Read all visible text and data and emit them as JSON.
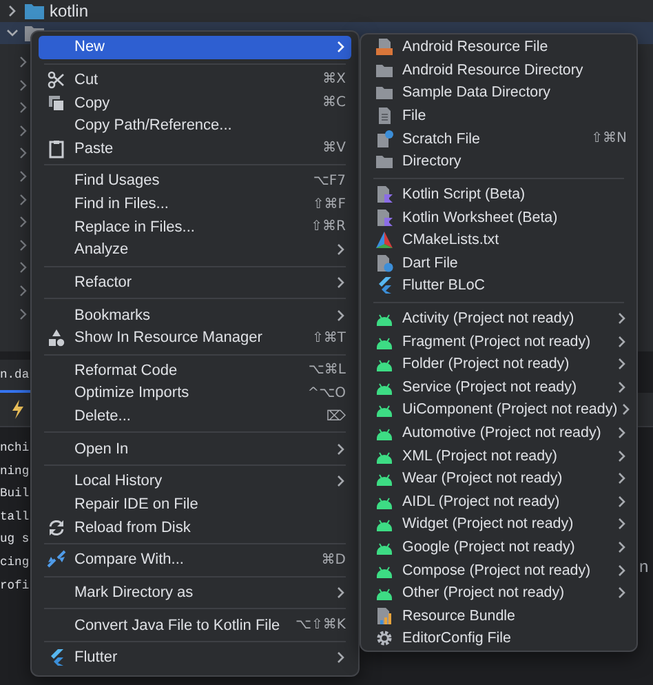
{
  "project_tree": {
    "items": [
      {
        "label": "kotlin",
        "expanded": false,
        "selected": false
      },
      {
        "expanded": true,
        "selected": true
      }
    ]
  },
  "editor_tab": {
    "label": "n.da"
  },
  "terminal": {
    "lines": [
      "nchi",
      "ning",
      "Buil",
      "tall",
      "ug s",
      "cing",
      "rofi"
    ]
  },
  "right_fragment": "n",
  "context_menu": {
    "groups": [
      [
        {
          "label": "New",
          "submenu": true,
          "selected": true
        }
      ],
      [
        {
          "label": "Cut",
          "shortcut": "⌘X",
          "submenu": false,
          "selected": false
        },
        {
          "label": "Copy",
          "shortcut": "⌘C",
          "submenu": false,
          "selected": false
        },
        {
          "label": "Copy Path/Reference...",
          "submenu": false,
          "selected": false
        },
        {
          "label": "Paste",
          "shortcut": "⌘V",
          "submenu": false,
          "selected": false
        }
      ],
      [
        {
          "label": "Find Usages",
          "shortcut": "⌥F7",
          "submenu": false,
          "selected": false
        },
        {
          "label": "Find in Files...",
          "shortcut": "⇧⌘F",
          "submenu": false,
          "selected": false
        },
        {
          "label": "Replace in Files...",
          "shortcut": "⇧⌘R",
          "submenu": false,
          "selected": false
        },
        {
          "label": "Analyze",
          "submenu": true,
          "selected": false
        }
      ],
      [
        {
          "label": "Refactor",
          "submenu": true,
          "selected": false
        }
      ],
      [
        {
          "label": "Bookmarks",
          "submenu": true,
          "selected": false
        },
        {
          "label": "Show In Resource Manager",
          "shortcut": "⇧⌘T",
          "submenu": false,
          "selected": false
        }
      ],
      [
        {
          "label": "Reformat Code",
          "shortcut": "⌥⌘L",
          "submenu": false,
          "selected": false
        },
        {
          "label": "Optimize Imports",
          "shortcut": "^⌥O",
          "submenu": false,
          "selected": false
        },
        {
          "label": "Delete...",
          "shortcut": "⌦",
          "submenu": false,
          "selected": false
        }
      ],
      [
        {
          "label": "Open In",
          "submenu": true,
          "selected": false
        }
      ],
      [
        {
          "label": "Local History",
          "submenu": true,
          "selected": false
        },
        {
          "label": "Repair IDE on File",
          "submenu": false,
          "selected": false
        },
        {
          "label": "Reload from Disk",
          "submenu": false,
          "selected": false
        }
      ],
      [
        {
          "label": "Compare With...",
          "shortcut": "⌘D",
          "submenu": false,
          "selected": false
        }
      ],
      [
        {
          "label": "Mark Directory as",
          "submenu": true,
          "selected": false
        }
      ],
      [
        {
          "label": "Convert Java File to Kotlin File",
          "shortcut": "⌥⇧⌘K",
          "submenu": false,
          "selected": false
        }
      ],
      [
        {
          "label": "Flutter",
          "submenu": true,
          "selected": false
        }
      ]
    ]
  },
  "new_submenu": {
    "groups": [
      [
        {
          "label": "Android Resource File",
          "submenu": false,
          "selected": false
        },
        {
          "label": "Android Resource Directory",
          "submenu": false,
          "selected": false
        },
        {
          "label": "Sample Data Directory",
          "submenu": false,
          "selected": false
        },
        {
          "label": "File",
          "submenu": false,
          "selected": false
        },
        {
          "label": "Scratch File",
          "shortcut": "⇧⌘N",
          "submenu": false,
          "selected": false
        },
        {
          "label": "Directory",
          "submenu": false,
          "selected": false
        }
      ],
      [
        {
          "label": "Kotlin Script (Beta)",
          "submenu": false,
          "selected": false
        },
        {
          "label": "Kotlin Worksheet (Beta)",
          "submenu": false,
          "selected": false
        },
        {
          "label": "CMakeLists.txt",
          "submenu": false,
          "selected": false
        },
        {
          "label": "Dart File",
          "submenu": false,
          "selected": false
        },
        {
          "label": "Flutter BLoC",
          "submenu": false,
          "selected": false
        }
      ],
      [
        {
          "label": "Activity (Project not ready)",
          "submenu": true,
          "selected": false
        },
        {
          "label": "Fragment (Project not ready)",
          "submenu": true,
          "selected": false
        },
        {
          "label": "Folder (Project not ready)",
          "submenu": true,
          "selected": false
        },
        {
          "label": "Service (Project not ready)",
          "submenu": true,
          "selected": false
        },
        {
          "label": "UiComponent (Project not ready)",
          "submenu": true,
          "selected": false
        },
        {
          "label": "Automotive (Project not ready)",
          "submenu": true,
          "selected": false
        },
        {
          "label": "XML (Project not ready)",
          "submenu": true,
          "selected": false
        },
        {
          "label": "Wear (Project not ready)",
          "submenu": true,
          "selected": false
        },
        {
          "label": "AIDL (Project not ready)",
          "submenu": true,
          "selected": false
        },
        {
          "label": "Widget (Project not ready)",
          "submenu": true,
          "selected": false
        },
        {
          "label": "Google (Project not ready)",
          "submenu": true,
          "selected": false
        },
        {
          "label": "Compose (Project not ready)",
          "submenu": true,
          "selected": false
        },
        {
          "label": "Other (Project not ready)",
          "submenu": true,
          "selected": false
        },
        {
          "label": "Resource Bundle",
          "submenu": false,
          "selected": false
        },
        {
          "label": "EditorConfig File",
          "submenu": false,
          "selected": false
        }
      ]
    ]
  }
}
